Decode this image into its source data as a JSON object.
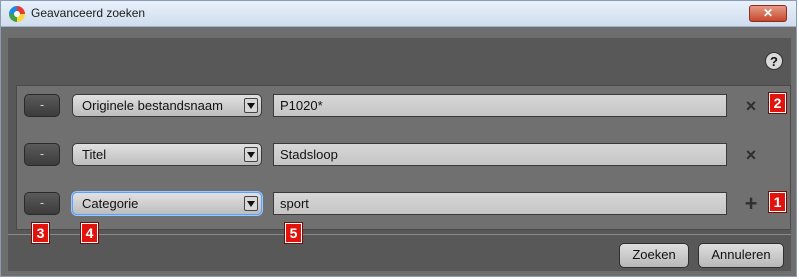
{
  "window": {
    "title": "Geavanceerd zoeken",
    "close_label": "✕",
    "help_label": "?"
  },
  "rows": [
    {
      "remove_label": "-",
      "field": "Originele bestandsnaam",
      "value": "P1020*",
      "action": "remove"
    },
    {
      "remove_label": "-",
      "field": "Titel",
      "value": "Stadsloop",
      "action": "remove"
    },
    {
      "remove_label": "-",
      "field": "Categorie",
      "value": "sport",
      "action": "add"
    }
  ],
  "icons": {
    "remove": "×",
    "add": "+"
  },
  "callouts": [
    "1",
    "2",
    "3",
    "4",
    "5"
  ],
  "footer": {
    "search_label": "Zoeken",
    "cancel_label": "Annuleren"
  },
  "colors": {
    "callout": "#e0140c",
    "focus": "#5aa0ff",
    "dialog_bg": "#585858"
  }
}
